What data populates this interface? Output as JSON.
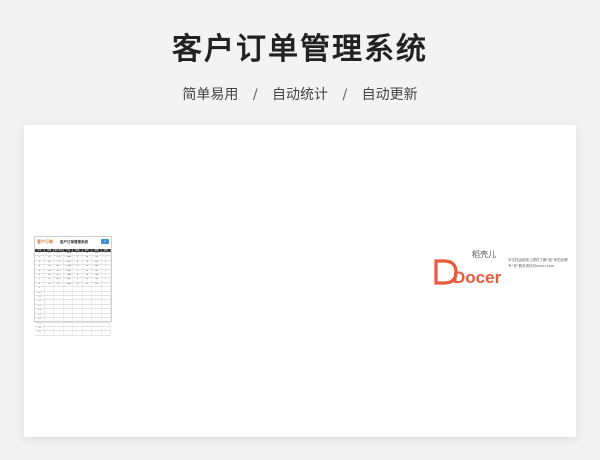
{
  "header": {
    "title": "客户订单管理系统",
    "features": [
      "简单易用",
      "自动统计",
      "自动更新"
    ],
    "separator": "/"
  },
  "sheet": {
    "logo_text": "客户订单",
    "title": "客户订单管理系统",
    "button_label": "+",
    "columns": [
      "序号",
      "日期",
      "客户名称",
      "产品",
      "数量",
      "单价",
      "金额",
      "状态"
    ],
    "rows": [
      [
        "1",
        "1/1",
        "张三",
        "产品A",
        "10",
        "20",
        "200",
        "√"
      ],
      [
        "2",
        "1/2",
        "李四",
        "产品B",
        "5",
        "30",
        "150",
        "√"
      ],
      [
        "3",
        "1/3",
        "王五",
        "产品C",
        "8",
        "15",
        "120",
        "√"
      ],
      [
        "4",
        "1/4",
        "赵六",
        "产品A",
        "12",
        "20",
        "240",
        "√"
      ],
      [
        "5",
        "1/5",
        "钱七",
        "产品D",
        "3",
        "50",
        "150",
        "√"
      ],
      [
        "6",
        "1/6",
        "孙八",
        "产品B",
        "6",
        "30",
        "180",
        "√"
      ],
      [
        "7",
        "1/7",
        "周九",
        "产品C",
        "9",
        "15",
        "135",
        "√"
      ],
      [
        "8",
        "1/8",
        "吴十",
        "产品A",
        "4",
        "20",
        "80",
        "√"
      ],
      [
        "9",
        "",
        "",
        "",
        "",
        "",
        "",
        ""
      ],
      [
        "10",
        "",
        "",
        "",
        "",
        "",
        "",
        ""
      ],
      [
        "11",
        "",
        "",
        "",
        "",
        "",
        "",
        ""
      ],
      [
        "12",
        "",
        "",
        "",
        "",
        "",
        "",
        ""
      ],
      [
        "13",
        "",
        "",
        "",
        "",
        "",
        "",
        ""
      ],
      [
        "14",
        "",
        "",
        "",
        "",
        "",
        "",
        ""
      ],
      [
        "15",
        "",
        "",
        "",
        "",
        "",
        "",
        ""
      ],
      [
        "16",
        "",
        "",
        "",
        "",
        "",
        "",
        ""
      ],
      [
        "17",
        "",
        "",
        "",
        "",
        "",
        "",
        ""
      ],
      [
        "18",
        "",
        "",
        "",
        "",
        "",
        "",
        ""
      ],
      [
        "19",
        "",
        "",
        "",
        "",
        "",
        "",
        ""
      ]
    ]
  },
  "docer": {
    "brand_cn": "稻壳儿",
    "wordmark": "Docer",
    "description": "本文档由稻壳儿提供了解“稻”你的品牌专“壳”服务请访问docer.com"
  },
  "colors": {
    "accent": "#e85a3c",
    "header_row": "#3a3a3a",
    "button": "#3a8fd6"
  }
}
